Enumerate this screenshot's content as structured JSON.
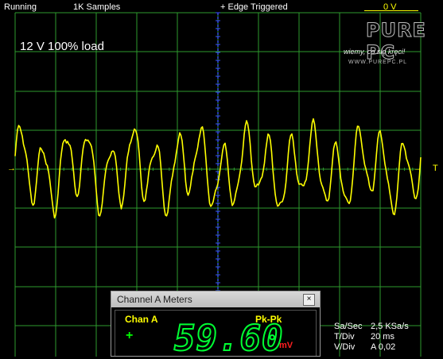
{
  "status_bar": {
    "state": "Running",
    "samples": "1K Samples",
    "trigger": "+ Edge Triggered",
    "trigger_level": "0 V"
  },
  "scope": {
    "annotation": "12 V 100% load",
    "trigger_marker": "T",
    "colors": {
      "trace": "#ffff00",
      "grid": "#2e9a2e",
      "center_axis": "#3a55ff",
      "meter_digits": "#00ff33"
    }
  },
  "logo": {
    "brand": "PURE PC",
    "tagline": "wiemy, co się kręci!",
    "url": "WWW.PUREPC.PL"
  },
  "meters_window": {
    "title": "Channel A Meters",
    "close_label": "×",
    "channel_label": "Chan A",
    "measurement_label": "Pk-Pk",
    "polarity": "+",
    "reading": "59.60",
    "unit": "mV"
  },
  "settings": [
    {
      "key": "Sa/Sec",
      "value": "2,5 KSa/s"
    },
    {
      "key": "T/Div",
      "value": "20 ms"
    },
    {
      "key": "V/Div",
      "value": "A 0,02"
    }
  ]
}
